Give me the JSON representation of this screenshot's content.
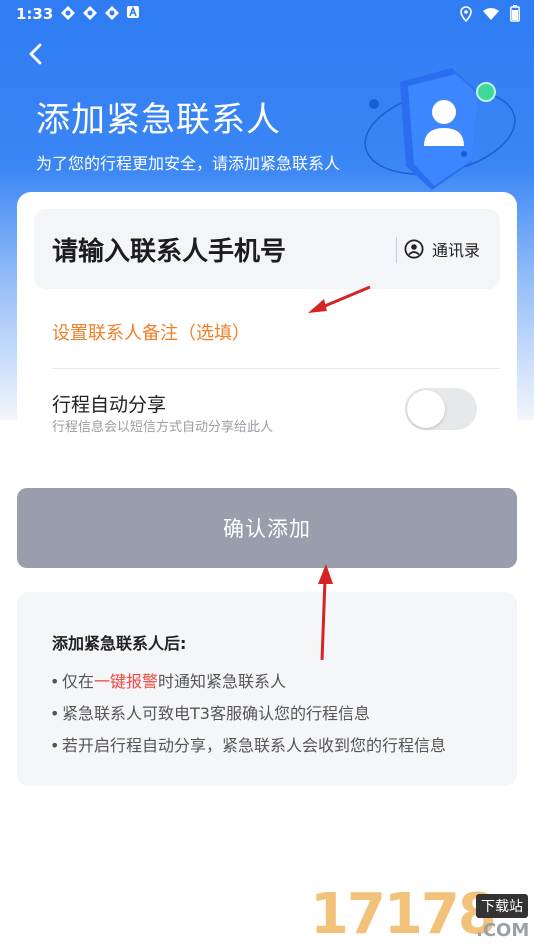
{
  "status_bar": {
    "time": "1:33",
    "left_icons": [
      "app-icon",
      "app-icon",
      "app-icon",
      "a-icon"
    ],
    "right_icons": [
      "location-icon",
      "wifi-icon",
      "battery-icon"
    ]
  },
  "header": {
    "back_icon": "chevron-left-icon",
    "title": "添加紧急联系人",
    "subtitle": "为了您的行程更加安全，请添加紧急联系人"
  },
  "form": {
    "phone_placeholder": "请输入联系人手机号",
    "contacts_label": "通讯录",
    "note_placeholder": "设置联系人备注（选填）",
    "share_title": "行程自动分享",
    "share_desc": "行程信息会以短信方式自动分享给此人",
    "share_enabled": false
  },
  "confirm_button": "确认添加",
  "info": {
    "title": "添加紧急联系人后:",
    "item1_prefix": "仅在",
    "item1_highlight": "一键报警",
    "item1_suffix": "时通知紧急联系人",
    "item2": "紧急联系人可致电T3客服确认您的行程信息",
    "item3": "若开启行程自动分享，紧急联系人会收到您的行程信息"
  },
  "watermark": {
    "number": "17178",
    "tag": "下载站",
    "domain": ".COM"
  },
  "colors": {
    "primary_blue": "#2f7cf3",
    "accent_orange": "#f0802a",
    "highlight_red": "#f0483e",
    "button_disabled": "#9a9dab"
  }
}
